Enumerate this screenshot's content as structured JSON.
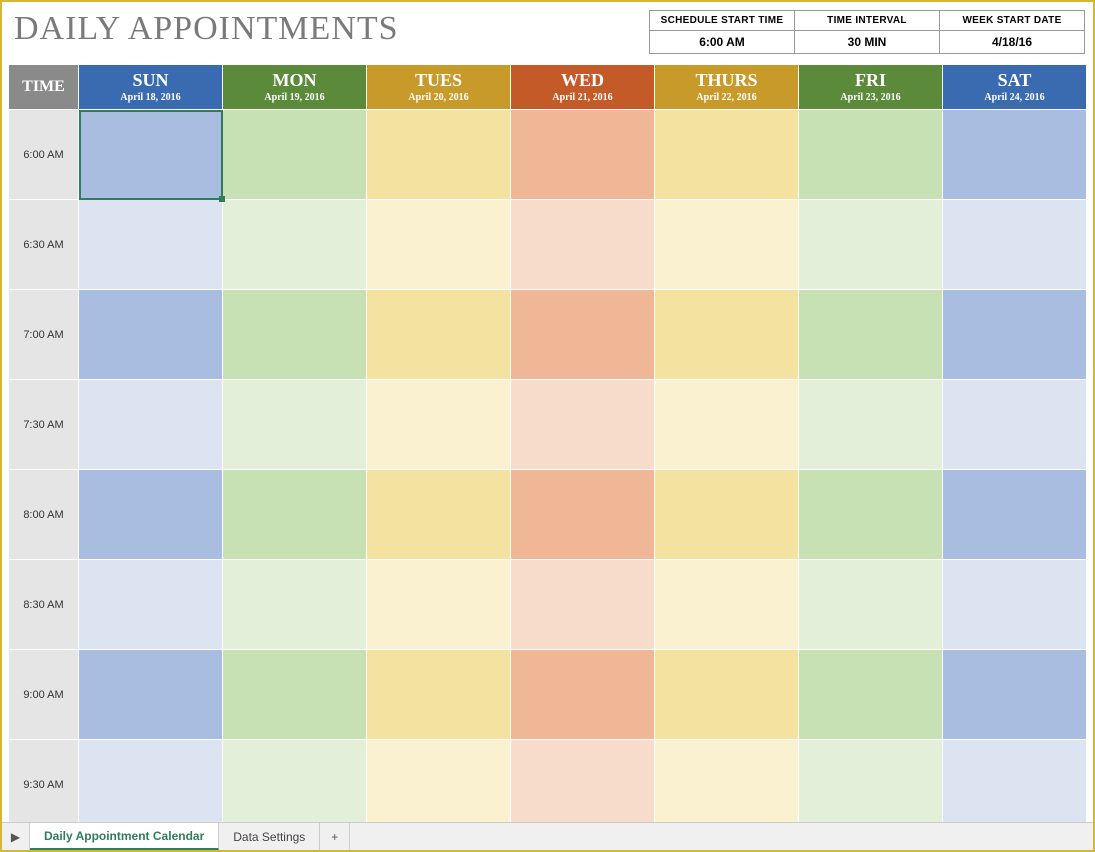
{
  "title": "DAILY APPOINTMENTS",
  "settings": {
    "headers": [
      "SCHEDULE START TIME",
      "TIME INTERVAL",
      "WEEK START DATE"
    ],
    "values": [
      "6:00 AM",
      "30 MIN",
      "4/18/16"
    ]
  },
  "schedule": {
    "time_header": "TIME",
    "days": [
      {
        "name": "SUN",
        "date": "April 18, 2016"
      },
      {
        "name": "MON",
        "date": "April 19, 2016"
      },
      {
        "name": "TUES",
        "date": "April 20, 2016"
      },
      {
        "name": "WED",
        "date": "April 21, 2016"
      },
      {
        "name": "THURS",
        "date": "April 22, 2016"
      },
      {
        "name": "FRI",
        "date": "April 23, 2016"
      },
      {
        "name": "SAT",
        "date": "April 24, 2016"
      }
    ],
    "time_rows": [
      "6:00 AM",
      "6:30 AM",
      "7:00 AM",
      "7:30 AM",
      "8:00 AM",
      "8:30 AM",
      "9:00 AM",
      "9:30 AM"
    ]
  },
  "sheet_tabs": {
    "active": "Daily Appointment Calendar",
    "inactive": "Data Settings",
    "nav_icon": "▶",
    "add_icon": "+"
  }
}
